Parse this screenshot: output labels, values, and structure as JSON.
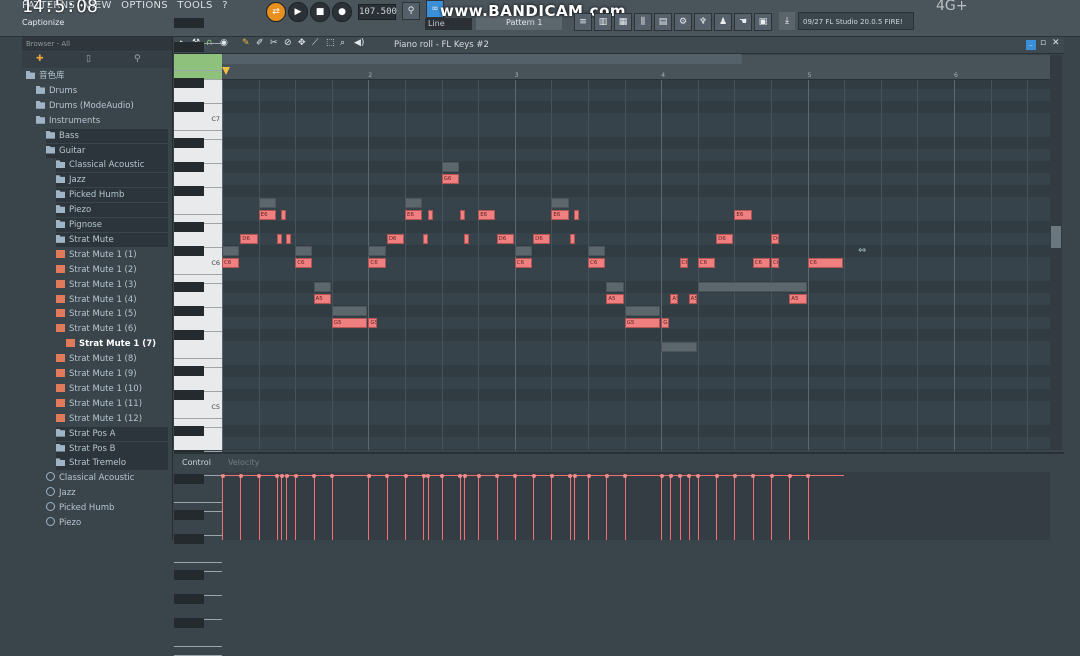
{
  "top": {
    "clock": "14:5:08",
    "menu": [
      "PATTERNS",
      "VIEW",
      "OPTIONS",
      "TOOLS",
      "?"
    ],
    "hint": "Captionize",
    "tempo": "107.500",
    "watermark": "www.BANDICAM.com",
    "line_mode": "Line",
    "pattern": "Pattern 1",
    "news": "09/27  FL Studio 20.0.5 FIRE!",
    "status": "4G+"
  },
  "browser": {
    "header": "Browser - All",
    "items": [
      {
        "label": "音色库",
        "type": "folder",
        "indent": 0
      },
      {
        "label": "Drums",
        "type": "folder",
        "indent": 1
      },
      {
        "label": "Drums (ModeAudio)",
        "type": "folder",
        "indent": 1
      },
      {
        "label": "Instruments",
        "type": "folder",
        "indent": 1
      },
      {
        "label": "Bass",
        "type": "folder",
        "indent": 2
      },
      {
        "label": "Guitar",
        "type": "folder",
        "indent": 2
      },
      {
        "label": "Classical Acoustic",
        "type": "folder",
        "indent": 3
      },
      {
        "label": "Jazz",
        "type": "folder",
        "indent": 3
      },
      {
        "label": "Picked Humb",
        "type": "folder",
        "indent": 3
      },
      {
        "label": "Piezo",
        "type": "folder",
        "indent": 3
      },
      {
        "label": "Pignose",
        "type": "folder",
        "indent": 3
      },
      {
        "label": "Strat Mute",
        "type": "folder",
        "indent": 3
      },
      {
        "label": "Strat Mute 1 (1)",
        "type": "preset",
        "indent": 3
      },
      {
        "label": "Strat Mute 1 (2)",
        "type": "preset",
        "indent": 3
      },
      {
        "label": "Strat Mute 1 (3)",
        "type": "preset",
        "indent": 3
      },
      {
        "label": "Strat Mute 1 (4)",
        "type": "preset",
        "indent": 3
      },
      {
        "label": "Strat Mute 1 (5)",
        "type": "preset",
        "indent": 3
      },
      {
        "label": "Strat Mute 1 (6)",
        "type": "preset",
        "indent": 3
      },
      {
        "label": "Strat Mute 1 (7)",
        "type": "preset",
        "indent": 4,
        "selected": true
      },
      {
        "label": "Strat Mute 1 (8)",
        "type": "preset",
        "indent": 3
      },
      {
        "label": "Strat Mute 1 (9)",
        "type": "preset",
        "indent": 3
      },
      {
        "label": "Strat Mute 1 (10)",
        "type": "preset",
        "indent": 3
      },
      {
        "label": "Strat Mute 1 (11)",
        "type": "preset",
        "indent": 3
      },
      {
        "label": "Strat Mute 1 (12)",
        "type": "preset",
        "indent": 3
      },
      {
        "label": "Strat Pos A",
        "type": "folder",
        "indent": 3
      },
      {
        "label": "Strat Pos B",
        "type": "folder",
        "indent": 3
      },
      {
        "label": "Strat Tremelo",
        "type": "folder",
        "indent": 3
      },
      {
        "label": "Classical Acoustic",
        "type": "plug",
        "indent": 2
      },
      {
        "label": "Jazz",
        "type": "plug",
        "indent": 2
      },
      {
        "label": "Picked Humb",
        "type": "plug",
        "indent": 2
      },
      {
        "label": "Piezo",
        "type": "plug",
        "indent": 2
      }
    ]
  },
  "piano_roll": {
    "title": "Piano roll - FL Keys #2",
    "bars": [
      "2",
      "3",
      "4",
      "5",
      "6"
    ],
    "key_labels": [
      "C7",
      "C6",
      "C5"
    ],
    "control_label": "Control",
    "velocity_label": "Velocity",
    "notes": [
      {
        "label": "C6",
        "beat": 0.0,
        "len": 0.5,
        "semi": 12
      },
      {
        "label": "D6",
        "beat": 0.5,
        "len": 0.5,
        "semi": 14
      },
      {
        "label": "E6",
        "beat": 1.0,
        "len": 0.5,
        "semi": 16
      },
      {
        "label": "",
        "beat": 1.5,
        "len": 0.12,
        "semi": 14
      },
      {
        "label": "",
        "beat": 1.62,
        "len": 0.12,
        "semi": 16
      },
      {
        "label": "",
        "beat": 1.75,
        "len": 0.12,
        "semi": 14
      },
      {
        "label": "C6",
        "beat": 2.0,
        "len": 0.5,
        "semi": 12
      },
      {
        "label": "A5",
        "beat": 2.5,
        "len": 0.5,
        "semi": 9
      },
      {
        "label": "G5",
        "beat": 3.0,
        "len": 1.0,
        "semi": 7
      },
      {
        "label": "G5",
        "beat": 4.0,
        "len": 0.25,
        "semi": 7
      },
      {
        "label": "C6",
        "beat": 4.0,
        "len": 0.5,
        "semi": 12
      },
      {
        "label": "D6",
        "beat": 4.5,
        "len": 0.5,
        "semi": 14
      },
      {
        "label": "E6",
        "beat": 5.0,
        "len": 0.5,
        "semi": 16
      },
      {
        "label": "",
        "beat": 5.5,
        "len": 0.12,
        "semi": 14
      },
      {
        "label": "",
        "beat": 5.62,
        "len": 0.12,
        "semi": 16
      },
      {
        "label": "G6",
        "beat": 6.0,
        "len": 0.5,
        "semi": 19
      },
      {
        "label": "",
        "beat": 6.5,
        "len": 0.12,
        "semi": 16
      },
      {
        "label": "",
        "beat": 6.62,
        "len": 0.12,
        "semi": 14
      },
      {
        "label": "E6",
        "beat": 7.0,
        "len": 0.5,
        "semi": 16
      },
      {
        "label": "D6",
        "beat": 7.5,
        "len": 0.5,
        "semi": 14
      },
      {
        "label": "D6",
        "beat": 8.5,
        "len": 0.5,
        "semi": 14
      },
      {
        "label": "C6",
        "beat": 8.0,
        "len": 0.5,
        "semi": 12
      },
      {
        "label": "E6",
        "beat": 9.0,
        "len": 0.5,
        "semi": 16
      },
      {
        "label": "",
        "beat": 9.5,
        "len": 0.12,
        "semi": 14
      },
      {
        "label": "",
        "beat": 9.62,
        "len": 0.12,
        "semi": 16
      },
      {
        "label": "C6",
        "beat": 10.0,
        "len": 0.5,
        "semi": 12
      },
      {
        "label": "A5",
        "beat": 10.5,
        "len": 0.5,
        "semi": 9
      },
      {
        "label": "G5",
        "beat": 11.0,
        "len": 1.0,
        "semi": 7
      },
      {
        "label": "G5",
        "beat": 12.0,
        "len": 0.25,
        "semi": 7
      },
      {
        "label": "A5",
        "beat": 12.25,
        "len": 0.25,
        "semi": 9
      },
      {
        "label": "C6",
        "beat": 12.5,
        "len": 0.25,
        "semi": 12
      },
      {
        "label": "A5",
        "beat": 12.75,
        "len": 0.25,
        "semi": 9
      },
      {
        "label": "C6",
        "beat": 13.0,
        "len": 0.5,
        "semi": 12
      },
      {
        "label": "D6",
        "beat": 13.5,
        "len": 0.5,
        "semi": 14
      },
      {
        "label": "E6",
        "beat": 14.0,
        "len": 0.5,
        "semi": 16
      },
      {
        "label": "C6",
        "beat": 14.5,
        "len": 0.5,
        "semi": 12
      },
      {
        "label": "D6",
        "beat": 15.0,
        "len": 0.25,
        "semi": 14
      },
      {
        "label": "C6",
        "beat": 15.0,
        "len": 0.25,
        "semi": 12
      },
      {
        "label": "A5",
        "beat": 15.5,
        "len": 0.5,
        "semi": 9
      },
      {
        "label": "C6",
        "beat": 16.0,
        "len": 1.0,
        "semi": 12
      }
    ],
    "ghost_notes": [
      {
        "beat": 0.0,
        "len": 0.5,
        "semi": 13
      },
      {
        "beat": 2.0,
        "len": 0.5,
        "semi": 13
      },
      {
        "beat": 2.5,
        "len": 0.5,
        "semi": 10
      },
      {
        "beat": 3.0,
        "len": 1.0,
        "semi": 8
      },
      {
        "beat": 6.0,
        "len": 0.5,
        "semi": 20
      },
      {
        "beat": 1.0,
        "len": 0.5,
        "semi": 17
      },
      {
        "beat": 5.0,
        "len": 0.5,
        "semi": 17
      },
      {
        "beat": 9.0,
        "len": 0.5,
        "semi": 17
      },
      {
        "beat": 10.0,
        "len": 0.5,
        "semi": 13
      },
      {
        "beat": 10.5,
        "len": 0.5,
        "semi": 10
      },
      {
        "beat": 11.0,
        "len": 1.0,
        "semi": 8
      },
      {
        "beat": 12.0,
        "len": 1.0,
        "semi": 5
      },
      {
        "beat": 13.0,
        "len": 3.0,
        "semi": 10
      },
      {
        "beat": 4.0,
        "len": 0.5,
        "semi": 13
      },
      {
        "beat": 8.0,
        "len": 0.5,
        "semi": 13
      }
    ],
    "velocity_beats": [
      0.0,
      0.5,
      1.0,
      1.5,
      1.62,
      1.75,
      2.0,
      2.5,
      3.0,
      4.0,
      4.0,
      4.5,
      5.0,
      5.5,
      5.62,
      6.0,
      6.5,
      6.62,
      7.0,
      7.5,
      8.0,
      8.5,
      9.0,
      9.5,
      9.62,
      10.0,
      10.5,
      11.0,
      12.0,
      12.25,
      12.5,
      12.75,
      13.0,
      13.5,
      14.0,
      14.5,
      15.0,
      15.5,
      16.0
    ]
  }
}
